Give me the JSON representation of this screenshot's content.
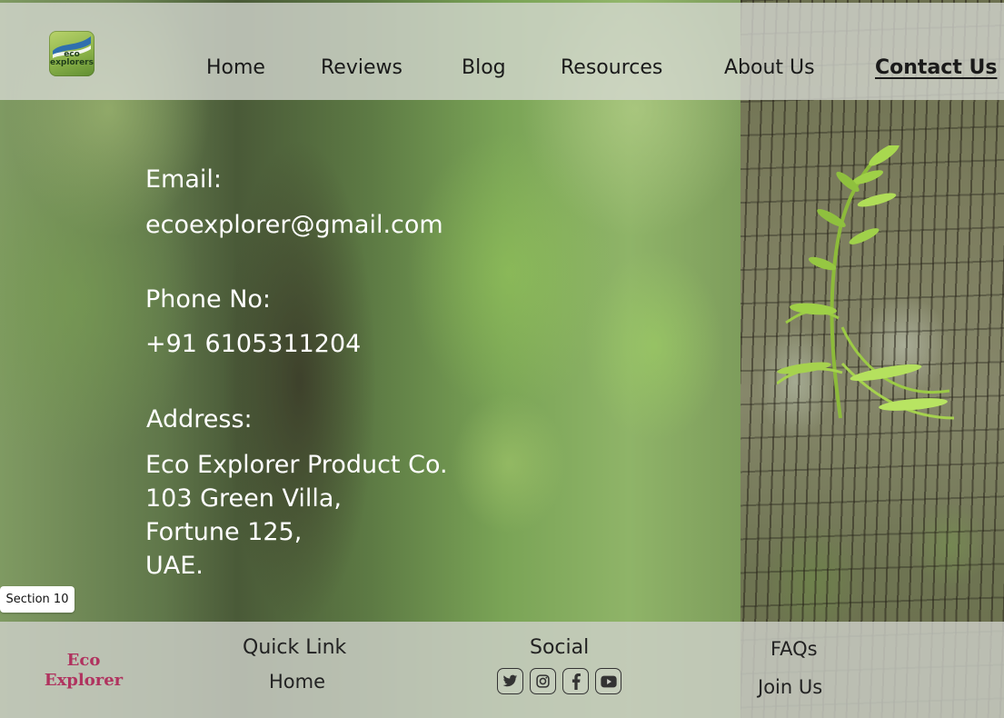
{
  "brand": {
    "logo_line1": "eco",
    "logo_line2": "explorers",
    "footer_line1": "Eco",
    "footer_line2": "Explorer"
  },
  "nav": {
    "items": [
      {
        "label": "Home"
      },
      {
        "label": "Reviews"
      },
      {
        "label": "Blog"
      },
      {
        "label": "Resources"
      },
      {
        "label": "About Us"
      },
      {
        "label": "Contact Us",
        "active": true
      }
    ]
  },
  "contact": {
    "email_label": "Email:",
    "email_value": "ecoexplorer@gmail.com",
    "phone_label": "Phone No:",
    "phone_value": "+91 6105311204",
    "address_label": "Address:",
    "address_lines": [
      "Eco Explorer Product Co.",
      "103 Green Villa,",
      "Fortune 125,",
      "UAE."
    ]
  },
  "section_tag": "Section 10",
  "footer": {
    "quick_link_heading": "Quick Link",
    "quick_links": [
      "Home"
    ],
    "social_heading": "Social",
    "social_icons": [
      "twitter-icon",
      "instagram-icon",
      "facebook-icon",
      "youtube-icon"
    ],
    "extra_links": [
      "FAQs",
      "Join Us"
    ]
  },
  "colors": {
    "brand_text": "#b0335f",
    "header_bg": "#d6d8d2",
    "footer_bg": "#cdcfc8",
    "contact_text": "#ffffff"
  }
}
